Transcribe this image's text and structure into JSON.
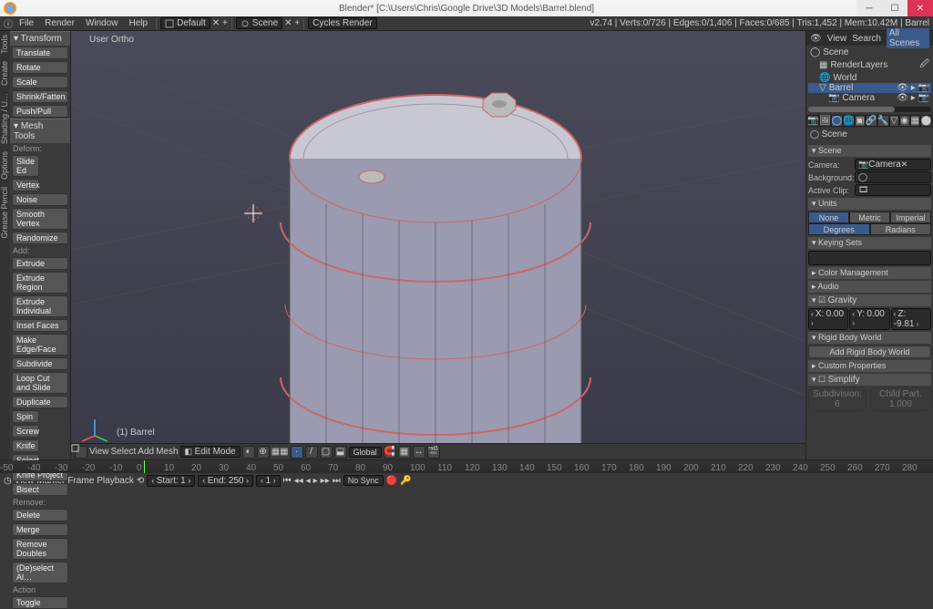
{
  "title": "Blender* [C:\\Users\\Chris\\Google Drive\\3D Models\\Barrel.blend]",
  "menu": {
    "items": [
      "File",
      "Render",
      "Window",
      "Help"
    ],
    "layout_dd": "Default",
    "scene_dd": "Scene",
    "engine": "Cycles Render",
    "stats": "v2.74 | Verts:0/726 | Edges:0/1,406 | Faces:0/685 | Tris:1,452 | Mem:10.42M | Barrel"
  },
  "user_ortho": "User Ortho",
  "object_name": "(1) Barrel",
  "left": {
    "tabs": [
      "Tools",
      "Create",
      "Shading / U…",
      "Options",
      "Grease Pencil"
    ],
    "transform": {
      "h": "Transform",
      "items": [
        "Translate",
        "Rotate",
        "Scale",
        "Shrink/Fatten",
        "Push/Pull"
      ]
    },
    "meshtools": {
      "h": "Mesh Tools",
      "deform": "Deform:",
      "slide": [
        "Slide Ed",
        "Vertex"
      ],
      "deformitems": [
        "Noise",
        "Smooth Vertex",
        "Randomize"
      ],
      "add": "Add:",
      "additems": [
        "Extrude",
        "Extrude Region",
        "Extrude Individual",
        "Inset Faces",
        "Make Edge/Face",
        "Subdivide",
        "Loop Cut and Slide",
        "Duplicate"
      ],
      "pair1": [
        "Spin",
        "Screw"
      ],
      "pair2": [
        "Knife",
        "Select"
      ],
      "post": [
        "Knife Project",
        "Bisect"
      ],
      "remove": "Remove:",
      "ritems": [
        "Delete",
        "Merge",
        "Remove Doubles"
      ]
    },
    "deselect": "(De)select Al…",
    "action": "Action",
    "toggle": "Toggle"
  },
  "vph": {
    "view": "View",
    "select": "Select",
    "add": "Add",
    "mesh": "Mesh",
    "mode": "Edit Mode",
    "global": "Global"
  },
  "right": {
    "toprow": [
      "View",
      "Search",
      "All Scenes"
    ],
    "outliner": [
      "Scene",
      "RenderLayers",
      "World",
      "Barrel",
      "Camera"
    ],
    "crumb": "Scene",
    "scene_h": "Scene",
    "camera_lbl": "Camera:",
    "camera_v": "Camera",
    "bg": "Background:",
    "clip": "Active Clip:",
    "units_h": "Units",
    "u1": [
      "None",
      "Metric",
      "Imperial"
    ],
    "u2": [
      "Degrees",
      "Radians"
    ],
    "ks_h": "Keying Sets",
    "cm": "Color Management",
    "audio": "Audio",
    "grav": "Gravity",
    "gx": "X:",
    "gxv": "0.00",
    "gy": "Y:",
    "gyv": "0.00",
    "gz": "Z:",
    "gzv": "-9.81",
    "rbw_h": "Rigid Body World",
    "rbw_btn": "Add Rigid Body World",
    "cp": "Custom Properties",
    "simp": "Simplify",
    "sub": "Subdivision:",
    "subv": "6",
    "cpart": "Child Part.",
    "cpartv": "1.000"
  },
  "tl": {
    "marks": [
      "-50",
      "-40",
      "-30",
      "-20",
      "-10",
      "0",
      "10",
      "20",
      "30",
      "40",
      "50",
      "60",
      "70",
      "80",
      "90",
      "100",
      "110",
      "120",
      "130",
      "140",
      "150",
      "160",
      "170",
      "180",
      "190",
      "200",
      "210",
      "220",
      "230",
      "240",
      "250",
      "260",
      "270",
      "280"
    ],
    "view": "View",
    "marker": "Marker",
    "frame": "Frame",
    "playback": "Playback",
    "start": "Start:",
    "sv": "1",
    "end": "End:",
    "ev": "250",
    "cv": "1",
    "nosync": "No Sync"
  }
}
